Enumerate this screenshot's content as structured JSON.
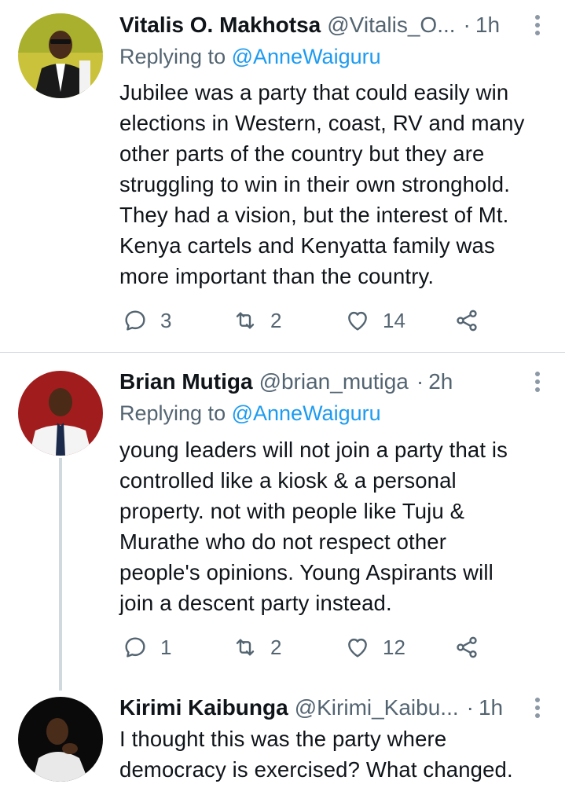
{
  "colors": {
    "accent": "#1d9bf0",
    "secondary_text": "#536471",
    "divider": "#cfd9de"
  },
  "tweets": [
    {
      "name": "Vitalis O. Makhotsa",
      "handle": "@Vitalis_O...",
      "dot": "·",
      "time": "1h",
      "replying_prefix": "Replying to",
      "replying_to": "@AnneWaiguru",
      "text": "Jubilee was a party that could easily win\nelections in Western, coast, RV and many\nother parts of the country but they are\nstruggling to win in their own stronghold.\nThey had a vision, but the interest of Mt.\nKenya cartels and Kenyatta family was\nmore important than the country.",
      "replies": "3",
      "retweets": "2",
      "likes": "14"
    },
    {
      "name": "Brian Mutiga",
      "handle": "@brian_mutiga",
      "dot": "·",
      "time": "2h",
      "replying_prefix": "Replying to",
      "replying_to": "@AnneWaiguru",
      "text": "young leaders  will not join a party that is\ncontrolled like a kiosk & a personal\nproperty. not with people like Tuju &\nMurathe who do not respect other\npeople's opinions. Young Aspirants will\njoin a descent party instead.",
      "replies": "1",
      "retweets": "2",
      "likes": "12"
    },
    {
      "name": "Kirimi Kaibunga",
      "handle": "@Kirimi_Kaibu...",
      "dot": "·",
      "time": "1h",
      "text": "I thought this was the party where\ndemocracy is exercised? What changed."
    }
  ]
}
